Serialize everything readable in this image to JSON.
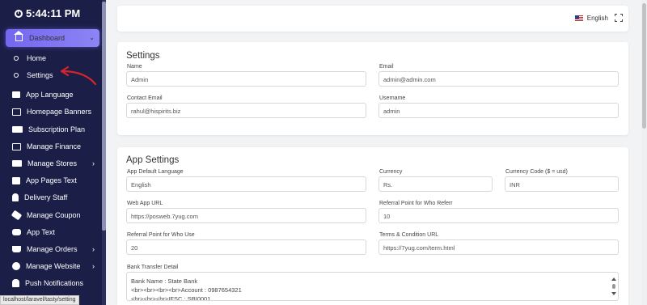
{
  "clock": {
    "time": "5:44:11 PM"
  },
  "sidebar": {
    "dashboard": "Dashboard",
    "items": [
      {
        "label": "Home",
        "icon": "circle-icon",
        "sub": true
      },
      {
        "label": "Settings",
        "icon": "circle-icon",
        "sub": true
      },
      {
        "label": "App Language",
        "icon": "flag-icon"
      },
      {
        "label": "Homepage Banners",
        "icon": "image-icon"
      },
      {
        "label": "Subscription Plan",
        "icon": "card-icon"
      },
      {
        "label": "Manage Finance",
        "icon": "money-icon"
      },
      {
        "label": "Manage Stores",
        "icon": "truck-icon",
        "arrow": "›"
      },
      {
        "label": "App Pages Text",
        "icon": "pages-icon"
      },
      {
        "label": "Delivery Staff",
        "icon": "user-icon"
      },
      {
        "label": "Manage Coupon",
        "icon": "tag-icon"
      },
      {
        "label": "App Text",
        "icon": "chat-icon"
      },
      {
        "label": "Manage Orders",
        "icon": "cart-icon",
        "arrow": "›"
      },
      {
        "label": "Manage Website",
        "icon": "globe-icon",
        "arrow": "›"
      },
      {
        "label": "Push Notifications",
        "icon": "bell-icon"
      }
    ]
  },
  "status_bar": {
    "url": "localhost/laravel/tasty/setting"
  },
  "topbar": {
    "language": "English"
  },
  "settings": {
    "title": "Settings",
    "name_label": "Name",
    "name_value": "Admin",
    "email_label": "Email",
    "email_value": "admin@admin.com",
    "contact_email_label": "Contact Email",
    "contact_email_value": "rahul@hispirits.biz",
    "username_label": "Username",
    "username_value": "admin"
  },
  "app_settings": {
    "title": "App Settings",
    "default_language_label": "App Default Language",
    "default_language_value": "English",
    "currency_label": "Currency",
    "currency_value": "Rs.",
    "currency_code_label": "Currency Code ($ = usd)",
    "currency_code_value": "INR",
    "web_app_url_label": "Web App URL",
    "web_app_url_value": "https://posweb.7yug.com",
    "referral_referr_label": "Referral Point for Who Referr",
    "referral_referr_value": "10",
    "referral_use_label": "Referral Point for Who Use",
    "referral_use_value": "20",
    "terms_url_label": "Terms & Condition URL",
    "terms_url_value": "https://7yug.com/term.html",
    "bank_label": "Bank Transfer Detail",
    "bank_line1": "Bank Name : State Bank",
    "bank_line2": "<br><br><br><br>Account : 0987654321",
    "bank_line3": "<br><br><br>IFSC : SBI0001"
  },
  "colors": {
    "sidebar_bg": "#1b1f48",
    "accent": "#7367f0",
    "annotation_arrow": "#d8232a"
  }
}
